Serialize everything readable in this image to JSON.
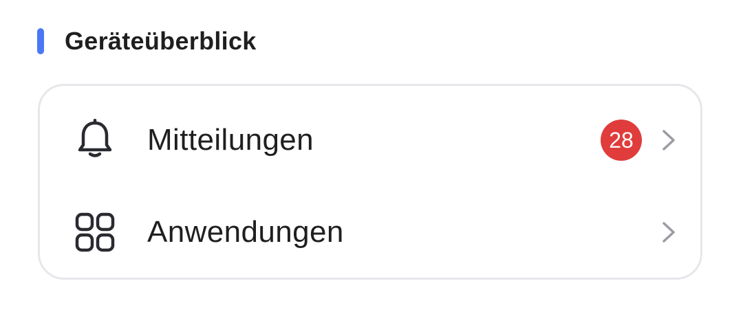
{
  "section": {
    "title": "Geräteüberblick",
    "accent_color": "#4a78f5"
  },
  "rows": [
    {
      "label": "Mitteilungen",
      "icon": "bell-icon",
      "badge": "28",
      "badge_color": "#e03c3c",
      "chevron_icon": "chevron-right-icon"
    },
    {
      "label": "Anwendungen",
      "icon": "apps-grid-icon",
      "chevron_icon": "chevron-right-icon"
    }
  ]
}
